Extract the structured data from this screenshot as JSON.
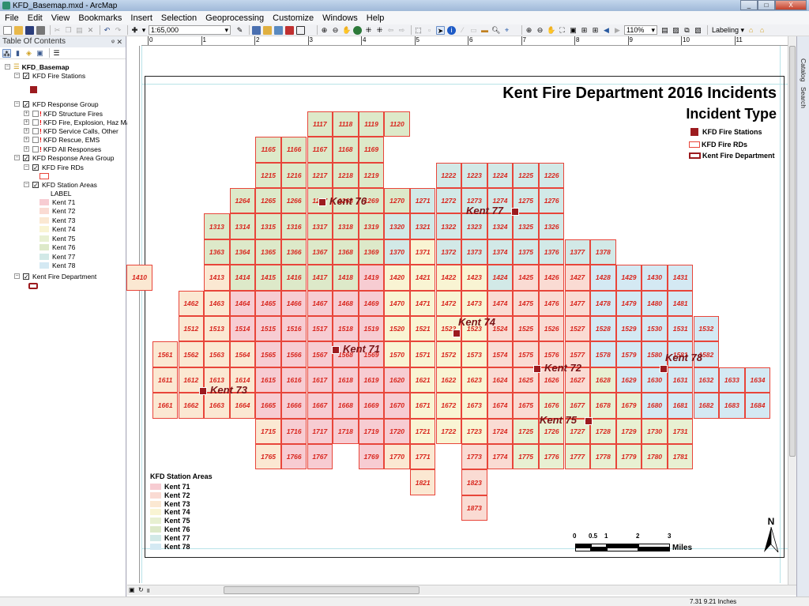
{
  "window": {
    "title": "KFD_Basemap.mxd - ArcMap"
  },
  "menu": [
    "File",
    "Edit",
    "View",
    "Bookmarks",
    "Insert",
    "Selection",
    "Geoprocessing",
    "Customize",
    "Windows",
    "Help"
  ],
  "toolbar": {
    "scale": "1:65,000",
    "zoom": "110%",
    "labeling": "Labeling"
  },
  "toc": {
    "title": "Table Of Contents",
    "root": "KFD_Basemap",
    "layers": [
      {
        "label": "KFD Fire Stations",
        "checked": true
      },
      {
        "label": "KFD Response Group",
        "checked": true
      },
      {
        "label": "KFD Structure Fires",
        "checked": false
      },
      {
        "label": "KFD Fire, Explosion, Haz Mat",
        "checked": false
      },
      {
        "label": "KFD Service Calls, Other",
        "checked": false
      },
      {
        "label": "KFD Rescue, EMS",
        "checked": false
      },
      {
        "label": "KFD All Responses",
        "checked": false
      },
      {
        "label": "KFD Response Area Group",
        "checked": true
      },
      {
        "label": "KFD Fire RDs",
        "checked": true
      },
      {
        "label": "KFD Station Areas",
        "checked": true
      },
      {
        "label": "Kent Fire Department",
        "checked": true
      }
    ],
    "field_label": "LABEL"
  },
  "stations": [
    {
      "name": "Kent 71",
      "color": "#f7ccd2"
    },
    {
      "name": "Kent 72",
      "color": "#fadbd3"
    },
    {
      "name": "Kent 73",
      "color": "#fbe8d2"
    },
    {
      "name": "Kent 74",
      "color": "#f9f4d3"
    },
    {
      "name": "Kent 75",
      "color": "#e8f0d2"
    },
    {
      "name": "Kent 76",
      "color": "#dde9c9"
    },
    {
      "name": "Kent 77",
      "color": "#d2e9e7"
    },
    {
      "name": "Kent 78",
      "color": "#d4e9f3"
    }
  ],
  "map": {
    "title": "Kent Fire Department 2016 Incidents",
    "subtitle": "Incident Type",
    "legend": {
      "stations": "KFD Fire Stations",
      "rds": "KFD Fire RDs",
      "boundary": "Kent Fire Department"
    },
    "areas_legend_title": "KFD Station Areas",
    "scale_ticks": [
      "0",
      "0.5",
      "1",
      "2",
      "3"
    ],
    "scale_unit": "Miles",
    "north": "N",
    "rd_by_station": {
      "Kent 71": [
        1419,
        1464,
        1465,
        1466,
        1467,
        1468,
        1469,
        1514,
        1515,
        1516,
        1517,
        1518,
        1519,
        1565,
        1566,
        1567,
        1568,
        1569,
        1615,
        1616,
        1617,
        1618,
        1619,
        1620,
        1665,
        1666,
        1667,
        1668,
        1669,
        1670,
        1716,
        1717,
        1718,
        1719,
        1720,
        1766,
        1767,
        1769
      ],
      "Kent 72": [
        1425,
        1426,
        1427,
        1474,
        1475,
        1476,
        1477,
        1524,
        1525,
        1526,
        1527,
        1574,
        1575,
        1576,
        1577,
        1624,
        1625,
        1626,
        1627,
        1674,
        1675,
        1724,
        1773,
        1774,
        1823,
        1873
      ],
      "Kent 73": [
        1410,
        1413,
        1462,
        1463,
        1512,
        1513,
        1561,
        1562,
        1563,
        1564,
        1611,
        1612,
        1613,
        1614,
        1661,
        1662,
        1663,
        1664,
        1715,
        1765,
        1770,
        1771,
        1821
      ],
      "Kent 74": [
        1371,
        1420,
        1421,
        1422,
        1423,
        1470,
        1471,
        1472,
        1473,
        1520,
        1521,
        1522,
        1523,
        1570,
        1571,
        1572,
        1573,
        1621,
        1622,
        1623,
        1671,
        1672,
        1673,
        1721,
        1722,
        1723
      ],
      "Kent 75": [
        1628,
        1676,
        1677,
        1678,
        1679,
        1725,
        1726,
        1727,
        1728,
        1729,
        1730,
        1731,
        1775,
        1776,
        1777,
        1778,
        1779,
        1780,
        1781
      ],
      "Kent 76": [
        1117,
        1118,
        1119,
        1120,
        1165,
        1166,
        1167,
        1168,
        1169,
        1215,
        1216,
        1217,
        1218,
        1219,
        1264,
        1265,
        1266,
        1267,
        1268,
        1269,
        1270,
        1313,
        1314,
        1315,
        1316,
        1317,
        1318,
        1319,
        1363,
        1364,
        1365,
        1366,
        1367,
        1368,
        1369,
        1414,
        1415,
        1416,
        1417,
        1418
      ],
      "Kent 77": [
        1222,
        1223,
        1224,
        1225,
        1226,
        1271,
        1272,
        1273,
        1274,
        1275,
        1276,
        1320,
        1321,
        1322,
        1323,
        1324,
        1325,
        1326,
        1370,
        1372,
        1373,
        1374,
        1375,
        1376,
        1377,
        1378,
        1424
      ],
      "Kent 78": [
        1428,
        1429,
        1430,
        1431,
        1478,
        1479,
        1480,
        1481,
        1528,
        1529,
        1530,
        1531,
        1532,
        1578,
        1579,
        1580,
        1581,
        1582,
        1629,
        1630,
        1631,
        1632,
        1633,
        1634,
        1680,
        1681,
        1682,
        1683,
        1684
      ]
    }
  },
  "rulers": {
    "top": [
      "0",
      "1",
      "2",
      "3",
      "4",
      "5",
      "6",
      "7",
      "8",
      "9",
      "10",
      "11"
    ]
  },
  "side_tabs": [
    "Catalog",
    "Search"
  ],
  "status": {
    "coords": "7.31  9.21 Inches"
  }
}
